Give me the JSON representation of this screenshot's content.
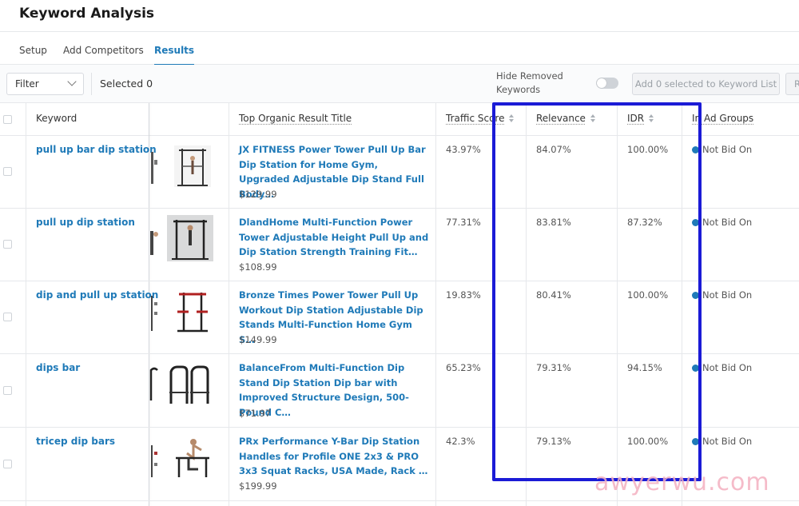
{
  "header": {
    "title": "Keyword Analysis"
  },
  "tabs": [
    {
      "label": "Setup",
      "active": false
    },
    {
      "label": "Add Competitors",
      "active": false
    },
    {
      "label": "Results",
      "active": true
    }
  ],
  "toolbar": {
    "filter_label": "Filter",
    "selected_text": "Selected 0",
    "hide_removed_label": "Hide Removed Keywords",
    "hide_removed_on": false,
    "add_button_label": "Add 0 selected to Keyword List",
    "extra_button_label": "R"
  },
  "columns": {
    "keyword": "Keyword",
    "title": "Top Organic Result Title",
    "traffic": "Traffic Score",
    "relevance": "Relevance",
    "idr": "IDR",
    "ad_groups": "In Ad Groups"
  },
  "rows": [
    {
      "keyword": "pull up bar dip station",
      "title": "JX FITNESS Power Tower Pull Up Bar Dip Station for Home Gym, Upgraded Adjustable Dip Stand Full Body…",
      "price": "$129.99",
      "traffic": "43.97%",
      "relevance": "84.07%",
      "idr": "100.00%",
      "ad_groups": "Not Bid On"
    },
    {
      "keyword": "pull up dip station",
      "title": "DlandHome Multi-Function Power Tower Adjustable Height Pull Up and Dip Station Strength Training Fit…",
      "price": "$108.99",
      "traffic": "77.31%",
      "relevance": "83.81%",
      "idr": "87.32%",
      "ad_groups": "Not Bid On"
    },
    {
      "keyword": "dip and pull up station",
      "title": "Bronze Times Power Tower Pull Up Workout Dip Station Adjustable Dip Stands Multi-Function Home Gym S…",
      "price": "$149.99",
      "traffic": "19.83%",
      "relevance": "80.41%",
      "idr": "100.00%",
      "ad_groups": "Not Bid On"
    },
    {
      "keyword": "dips bar",
      "title": "BalanceFrom Multi-Function Dip Stand Dip Station Dip bar with Improved Structure Design, 500-Pound C…",
      "price": "$71.97",
      "traffic": "65.23%",
      "relevance": "79.31%",
      "idr": "94.15%",
      "ad_groups": "Not Bid On"
    },
    {
      "keyword": "tricep dip bars",
      "title": "PRx Performance Y-Bar Dip Station Handles for Profile ONE 2x3 & PRO 3x3 Squat Racks, USA Made, Rack …",
      "price": "$199.99",
      "traffic": "42.3%",
      "relevance": "79.13%",
      "idr": "100.00%",
      "ad_groups": "Not Bid On"
    }
  ],
  "watermark": "awyerwu.com",
  "colors": {
    "accent": "#1f7ab8",
    "highlight": "#1b1bd6",
    "watermark": "#f4b0c0"
  }
}
